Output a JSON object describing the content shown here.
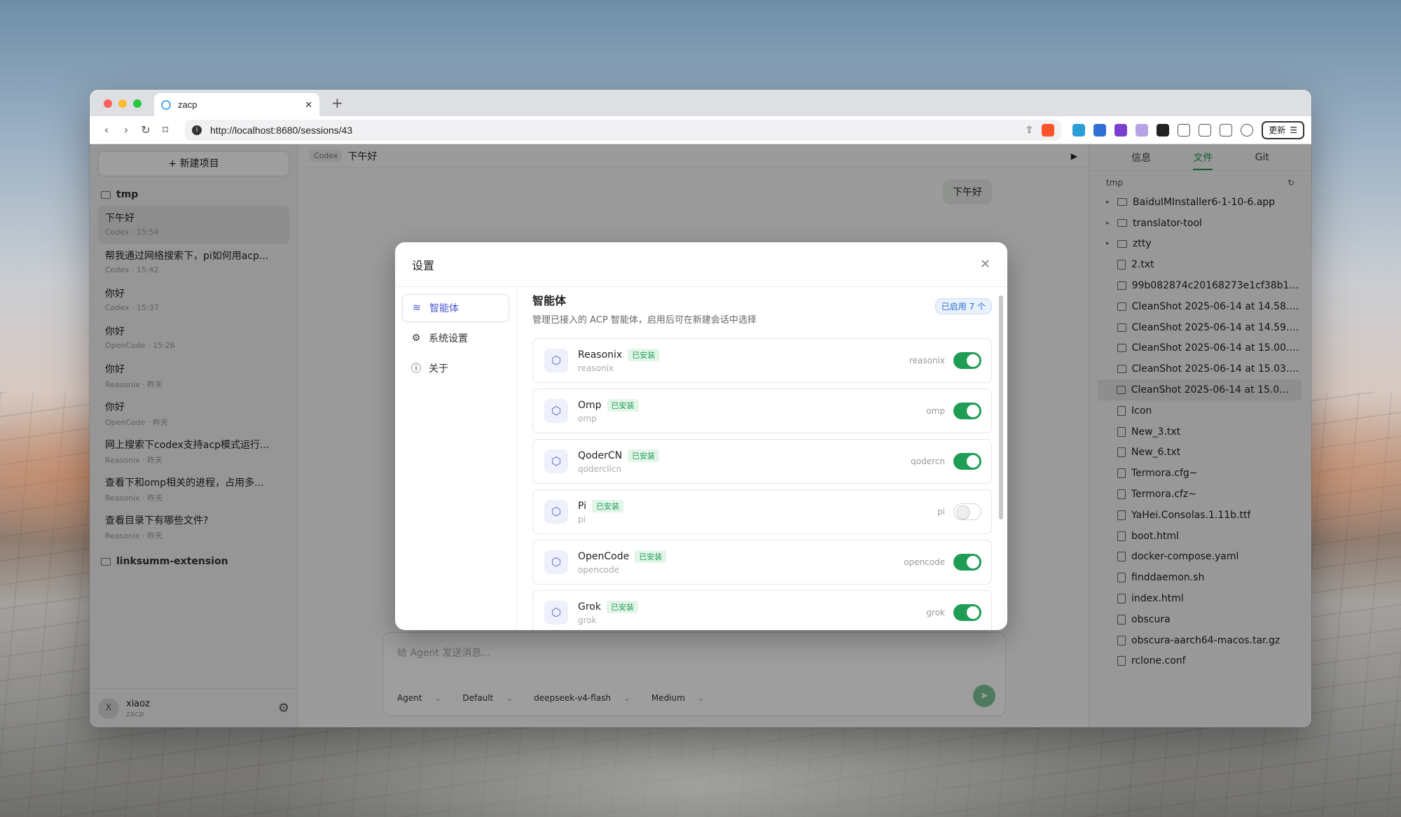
{
  "browser": {
    "tab_title": "zacp",
    "url": "http://localhost:8680/sessions/43",
    "update_label": "更新"
  },
  "sidebar": {
    "new_project": "+ 新建项目",
    "projects": [
      {
        "name": "tmp"
      },
      {
        "name": "linksumm-extension"
      }
    ],
    "sessions": [
      {
        "title": "下午好",
        "meta": "Codex · 15:54"
      },
      {
        "title": "帮我通过网络搜索下，pi如何用acp...",
        "meta": "Codex · 15:42"
      },
      {
        "title": "你好",
        "meta": "Codex · 15:37"
      },
      {
        "title": "你好",
        "meta": "OpenCode · 15:26"
      },
      {
        "title": "你好",
        "meta": "Reasonix · 昨天"
      },
      {
        "title": "你好",
        "meta": "OpenCode · 昨天"
      },
      {
        "title": "网上搜索下codex支持acp模式运行...",
        "meta": "Reasonix · 昨天"
      },
      {
        "title": "查看下和omp相关的进程，占用多...",
        "meta": "Reasonix · 昨天"
      },
      {
        "title": "查看目录下有哪些文件?",
        "meta": "Reasonix · 昨天"
      }
    ],
    "user": {
      "avatar": "X",
      "name": "xiaoz",
      "app": "zacp"
    }
  },
  "chat": {
    "agent_badge": "Codex",
    "title": "下午好",
    "message": "下午好",
    "placeholder": "给 Agent 发送消息...",
    "options": [
      "Agent",
      "Default",
      "deepseek-v4-flash",
      "Medium"
    ]
  },
  "rpanel": {
    "tabs": [
      "信息",
      "文件",
      "Git"
    ],
    "path": "tmp",
    "files": [
      {
        "name": "BaiduIMInstaller6-1-10-6.app",
        "type": "dir"
      },
      {
        "name": "translator-tool",
        "type": "dir"
      },
      {
        "name": "ztty",
        "type": "dir"
      },
      {
        "name": "2.txt",
        "type": "file"
      },
      {
        "name": "99b082874c20168273e1cf38b11...",
        "type": "img"
      },
      {
        "name": "CleanShot 2025-06-14 at 14.58.0...",
        "type": "img"
      },
      {
        "name": "CleanShot 2025-06-14 at 14.59.2...",
        "type": "img"
      },
      {
        "name": "CleanShot 2025-06-14 at 15.00.5...",
        "type": "img"
      },
      {
        "name": "CleanShot 2025-06-14 at 15.03.3...",
        "type": "img"
      },
      {
        "name": "CleanShot 2025-06-14 at 15.03.5...",
        "type": "img"
      },
      {
        "name": "Icon",
        "type": "file"
      },
      {
        "name": "New_3.txt",
        "type": "file"
      },
      {
        "name": "New_6.txt",
        "type": "file"
      },
      {
        "name": "Termora.cfg~",
        "type": "file"
      },
      {
        "name": "Termora.cfz~",
        "type": "file"
      },
      {
        "name": "YaHei.Consolas.1.11b.ttf",
        "type": "file"
      },
      {
        "name": "boot.html",
        "type": "file"
      },
      {
        "name": "docker-compose.yaml",
        "type": "file"
      },
      {
        "name": "finddaemon.sh",
        "type": "file"
      },
      {
        "name": "index.html",
        "type": "file"
      },
      {
        "name": "obscura",
        "type": "file"
      },
      {
        "name": "obscura-aarch64-macos.tar.gz",
        "type": "file"
      },
      {
        "name": "rclone.conf",
        "type": "file"
      }
    ]
  },
  "modal": {
    "title": "设置",
    "nav": [
      {
        "label": "智能体",
        "icon": "database-icon"
      },
      {
        "label": "系统设置",
        "icon": "gear-icon"
      },
      {
        "label": "关于",
        "icon": "info-icon"
      }
    ],
    "section_title": "智能体",
    "section_desc": "管理已接入的 ACP 智能体，启用后可在新建会话中选择",
    "enabled_badge": "已启用 7 个",
    "installed_label": "已安装",
    "agents": [
      {
        "name": "Reasonix",
        "cmd": "reasonix",
        "bin": "reasonix",
        "enabled": true
      },
      {
        "name": "Omp",
        "cmd": "omp",
        "bin": "omp",
        "enabled": true
      },
      {
        "name": "QoderCN",
        "cmd": "qoderclicn",
        "bin": "qodercn",
        "enabled": true
      },
      {
        "name": "Pi",
        "cmd": "pi",
        "bin": "pi",
        "enabled": false
      },
      {
        "name": "OpenCode",
        "cmd": "opencode",
        "bin": "opencode",
        "enabled": true
      },
      {
        "name": "Grok",
        "cmd": "grok",
        "bin": "grok",
        "enabled": true
      }
    ]
  }
}
